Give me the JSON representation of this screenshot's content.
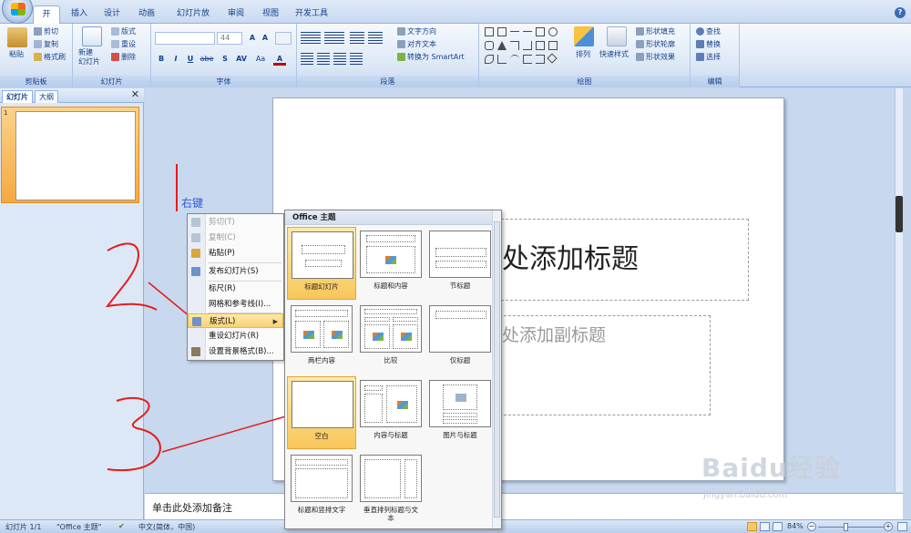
{
  "ribbon": {
    "tabs": [
      "开始",
      "插入",
      "设计",
      "动画",
      "幻灯片放映",
      "审阅",
      "视图",
      "开发工具"
    ],
    "active_tab": "开始",
    "clipboard": {
      "paste": "粘贴",
      "cut": "剪切",
      "copy": "复制",
      "format_painter": "格式刷",
      "label": "剪贴板"
    },
    "slides": {
      "new_slide": "新建\n幻灯片",
      "layout": "版式",
      "reset": "重设",
      "delete": "删除",
      "label": "幻灯片"
    },
    "font": {
      "size": "44",
      "bold": "B",
      "italic": "I",
      "underline": "U",
      "strike": "abe",
      "shadow": "S",
      "spacing": "AV",
      "case": "Aa",
      "color": "A",
      "label": "字体"
    },
    "paragraph": {
      "text_direction": "文字方向",
      "align_text": "对齐文本",
      "smartart": "转换为 SmartArt",
      "label": "段落"
    },
    "drawing": {
      "arrange": "排列",
      "quick_styles": "快速样式",
      "shape_fill": "形状填充",
      "shape_outline": "形状轮廓",
      "shape_effects": "形状效果",
      "label": "绘图"
    },
    "editing": {
      "find": "查找",
      "replace": "替换",
      "select": "选择",
      "label": "编辑"
    },
    "help": "?"
  },
  "panel": {
    "tabs": [
      "幻灯片",
      "大纲"
    ],
    "close": "✕",
    "slide_number": "1"
  },
  "slide": {
    "title_placeholder": "处添加标题",
    "subtitle_placeholder": "处添加副标题"
  },
  "notes": {
    "placeholder": "单击此处添加备注"
  },
  "status": {
    "slide": "幻灯片 1/1",
    "theme": "\"Office 主题\"",
    "language": "中文(简体，中国)",
    "zoom": "84%",
    "zoom_minus": "−",
    "zoom_plus": "+"
  },
  "annotation": {
    "right_click": "右键"
  },
  "context_menu": {
    "items": [
      {
        "label": "剪切(T)",
        "enabled": false
      },
      {
        "label": "复制(C)",
        "enabled": false
      },
      {
        "label": "粘贴(P)",
        "enabled": true
      },
      {
        "label": "发布幻灯片(S)",
        "enabled": true
      },
      {
        "label": "标尺(R)",
        "enabled": true
      },
      {
        "label": "网格和参考线(I)...",
        "enabled": true
      },
      {
        "label": "版式(L)",
        "enabled": true,
        "submenu": true
      },
      {
        "label": "重设幻灯片(R)",
        "enabled": true
      },
      {
        "label": "设置背景格式(B)...",
        "enabled": true
      }
    ],
    "submenu_arrow": "▶"
  },
  "layout_gallery": {
    "header": "Office 主题",
    "layouts": [
      "标题幻灯片",
      "标题和内容",
      "节标题",
      "两栏内容",
      "比较",
      "仅标题",
      "空白",
      "内容与标题",
      "图片与标题",
      "标题和竖排文字",
      "垂直排列标题与文\n本"
    ],
    "selected": "空白"
  },
  "watermark": {
    "brand": "Baidu经验",
    "url": "jingyan.baidu.com"
  },
  "colors": {
    "ribbon_blue": "#15428b",
    "annotation_red": "#e51c1c",
    "selection_orange": "#f8c75c"
  }
}
